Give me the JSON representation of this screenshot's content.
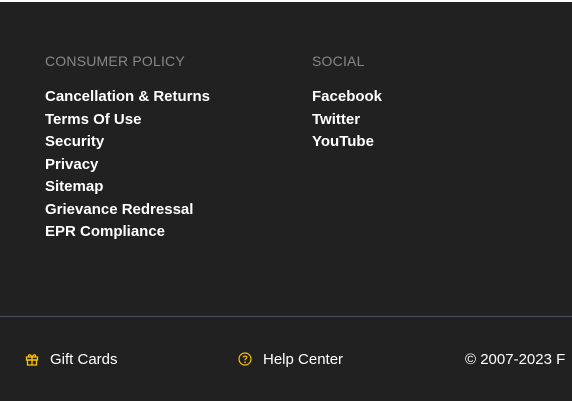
{
  "colors": {
    "background": "#212121",
    "heading": "#878787",
    "link": "#ffffff",
    "icon_accent": "#ffc200",
    "divider": "#454d5e"
  },
  "consumer_policy": {
    "heading": "CONSUMER POLICY",
    "links": [
      "Cancellation & Returns",
      "Terms Of Use",
      "Security",
      "Privacy",
      "Sitemap",
      "Grievance Redressal",
      "EPR Compliance"
    ]
  },
  "social": {
    "heading": "SOCIAL",
    "links": [
      "Facebook",
      "Twitter",
      "YouTube"
    ]
  },
  "bottom_bar": {
    "gift_cards": {
      "label": "Gift Cards",
      "icon": "gift-icon"
    },
    "help_center": {
      "label": "Help Center",
      "icon": "help-circle-icon"
    },
    "copyright": "© 2007-2023 F"
  }
}
